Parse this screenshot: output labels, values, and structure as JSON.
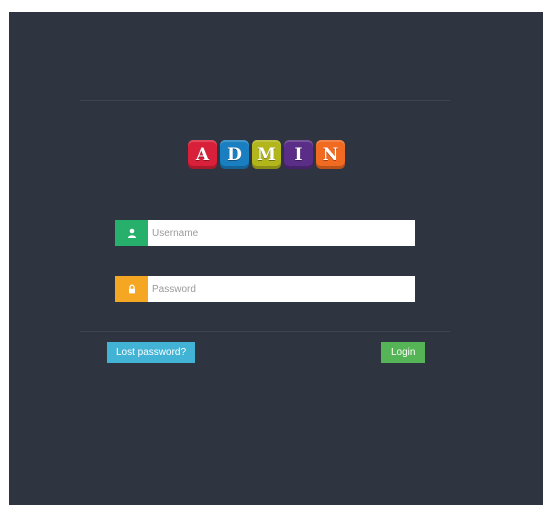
{
  "logo": {
    "letters": [
      "A",
      "D",
      "M",
      "I",
      "N"
    ],
    "colors": [
      "#d8203a",
      "#1a7fc1",
      "#b3b51d",
      "#5a2e87",
      "#f06a22"
    ]
  },
  "username": {
    "placeholder": "Username",
    "value": "",
    "icon": "user-icon",
    "accent": "#27b06b"
  },
  "password": {
    "placeholder": "Password",
    "value": "",
    "icon": "lock-icon",
    "accent": "#f5a623"
  },
  "buttons": {
    "lost_password": "Lost password?",
    "login": "Login"
  },
  "colors": {
    "background": "#2f3540",
    "lost_button": "#43b3d5",
    "login_button": "#55b455"
  }
}
